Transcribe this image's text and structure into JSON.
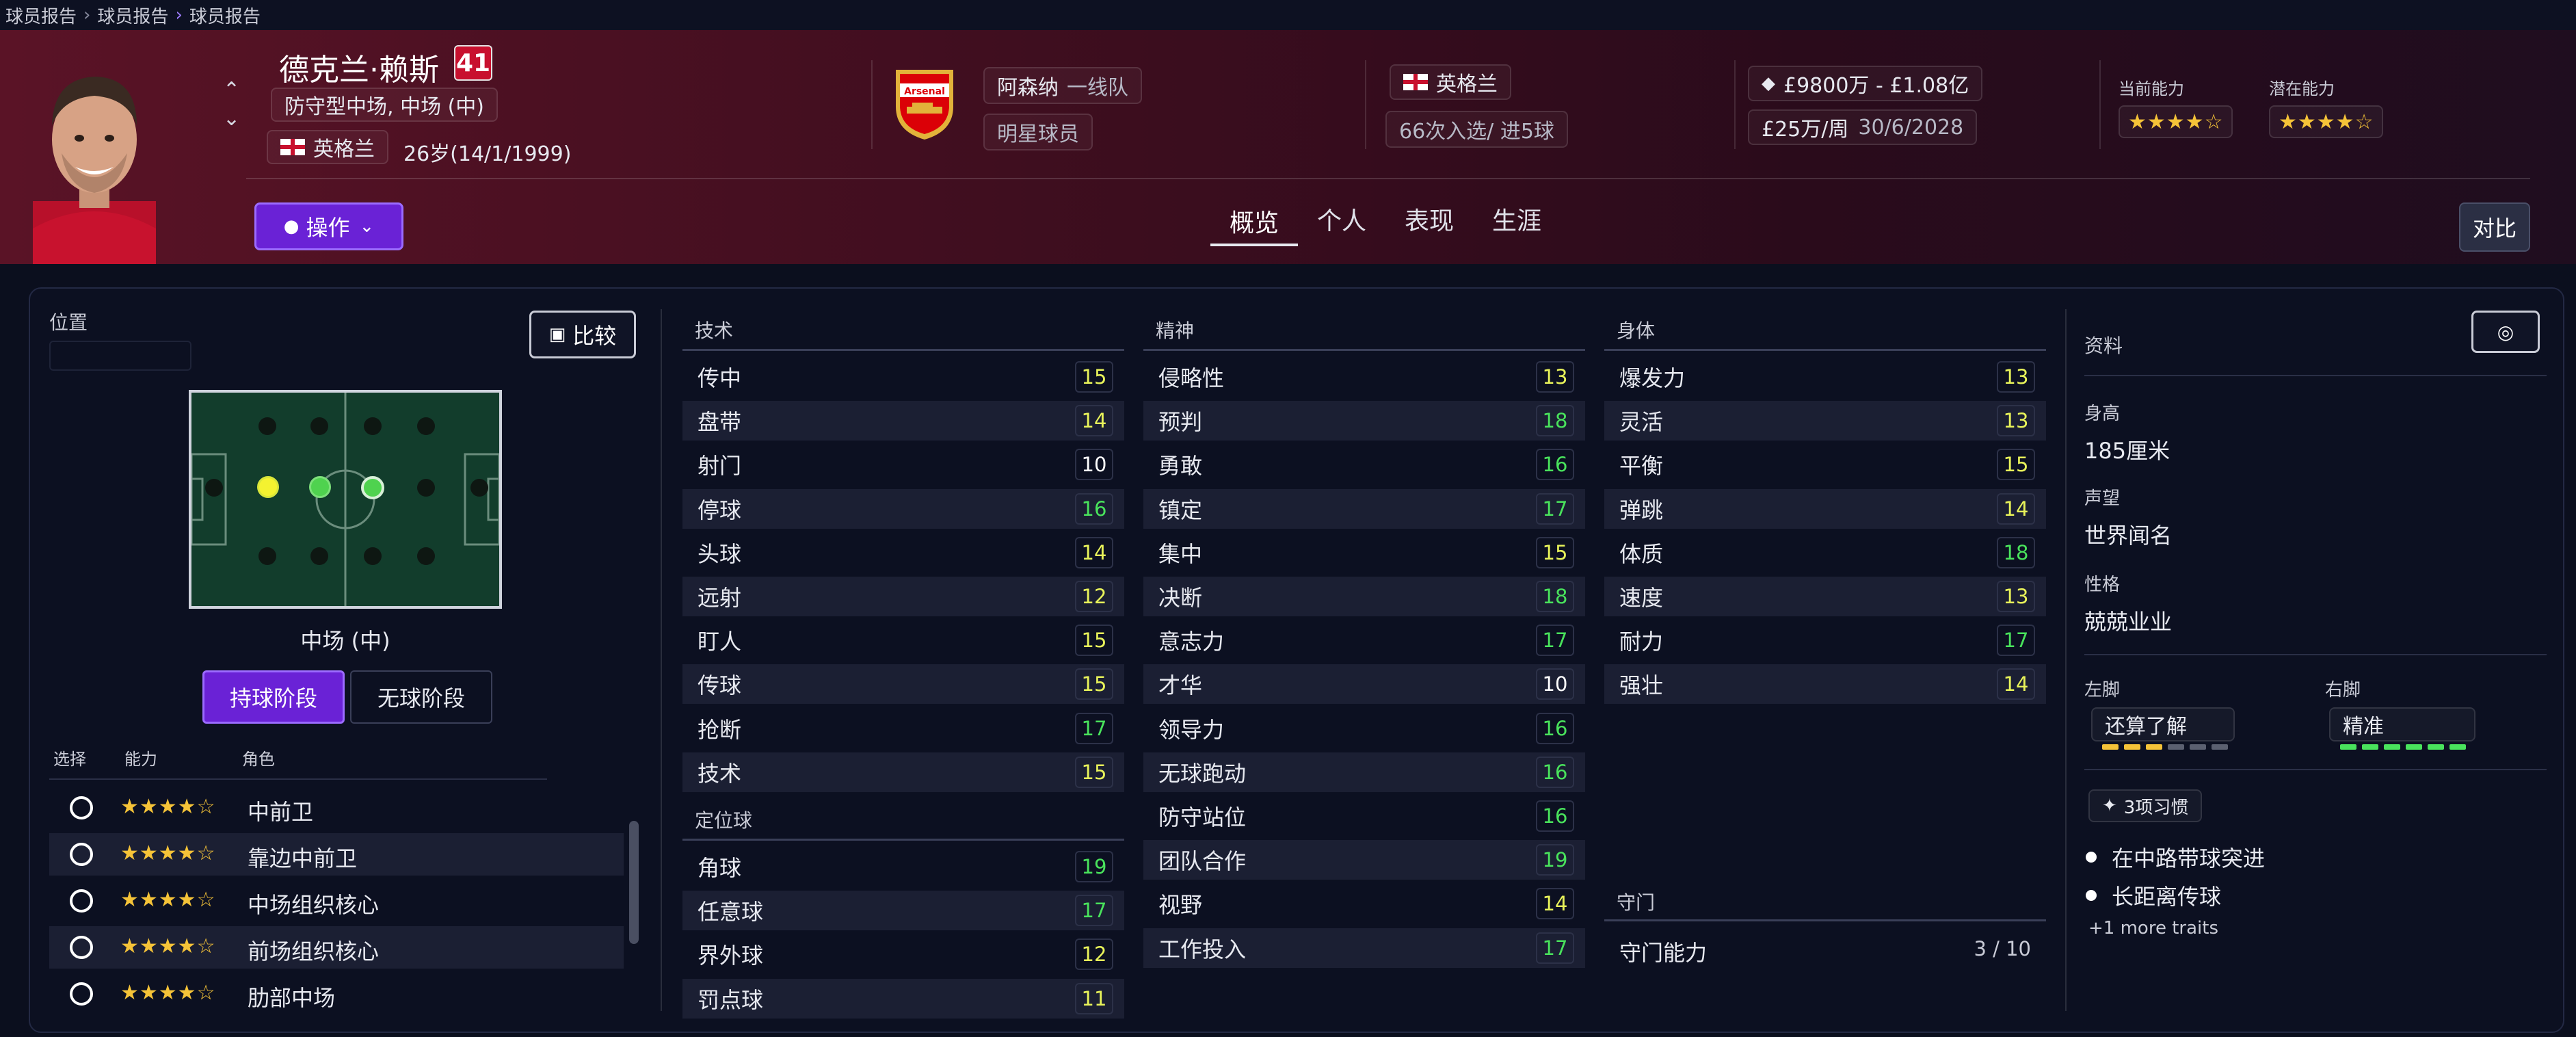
{
  "breadcrumb": [
    "球员报告",
    "球员报告",
    "球员报告"
  ],
  "player": {
    "name": "德克兰·赖斯",
    "number": "41",
    "position": "防守型中场, 中场 (中)",
    "nationality": "英格兰",
    "age": "26岁(14/1/1999)"
  },
  "club": {
    "name": "阿森纳",
    "squad": "一线队",
    "status": "明星球员",
    "crest_text": "Arsenal"
  },
  "international": {
    "country": "英格兰",
    "caps": "66次入选/ 进5球"
  },
  "contract": {
    "value": "£9800万 - £1.08亿",
    "wage": "£25万/周",
    "expiry": "30/6/2028"
  },
  "ability": {
    "current_label": "当前能力",
    "potential_label": "潜在能力",
    "current_stars": "★★★★☆",
    "potential_stars": "★★★★☆"
  },
  "actions_label": "操作",
  "tabs": [
    "概览",
    "个人",
    "表现",
    "生涯"
  ],
  "compare_label": "对比",
  "positions": {
    "title": "位置",
    "compare_button": "比较",
    "pitch_label": "中场 (中)",
    "phase_in": "持球阶段",
    "phase_out": "无球阶段",
    "col_select": "选择",
    "col_ability": "能力",
    "col_role": "角色",
    "roles": [
      {
        "stars": "★★★★☆",
        "name": "中前卫"
      },
      {
        "stars": "★★★★☆",
        "name": "靠边中前卫"
      },
      {
        "stars": "★★★★☆",
        "name": "中场组织核心"
      },
      {
        "stars": "★★★★☆",
        "name": "前场组织核心"
      },
      {
        "stars": "★★★★☆",
        "name": "肋部中场"
      }
    ]
  },
  "technical": {
    "title": "技术",
    "items": [
      {
        "name": "传中",
        "value": "15"
      },
      {
        "name": "盘带",
        "value": "14"
      },
      {
        "name": "射门",
        "value": "10"
      },
      {
        "name": "停球",
        "value": "16"
      },
      {
        "name": "头球",
        "value": "14"
      },
      {
        "name": "远射",
        "value": "12"
      },
      {
        "name": "盯人",
        "value": "15"
      },
      {
        "name": "传球",
        "value": "15"
      },
      {
        "name": "抢断",
        "value": "17"
      },
      {
        "name": "技术",
        "value": "15"
      }
    ]
  },
  "set_pieces": {
    "title": "定位球",
    "items": [
      {
        "name": "角球",
        "value": "19"
      },
      {
        "name": "任意球",
        "value": "17"
      },
      {
        "name": "界外球",
        "value": "12"
      },
      {
        "name": "罚点球",
        "value": "11"
      }
    ]
  },
  "mental": {
    "title": "精神",
    "items": [
      {
        "name": "侵略性",
        "value": "13"
      },
      {
        "name": "预判",
        "value": "18"
      },
      {
        "name": "勇敢",
        "value": "16"
      },
      {
        "name": "镇定",
        "value": "17"
      },
      {
        "name": "集中",
        "value": "15"
      },
      {
        "name": "决断",
        "value": "18"
      },
      {
        "name": "意志力",
        "value": "17"
      },
      {
        "name": "才华",
        "value": "10"
      },
      {
        "name": "领导力",
        "value": "16"
      },
      {
        "name": "无球跑动",
        "value": "16"
      },
      {
        "name": "防守站位",
        "value": "16"
      },
      {
        "name": "团队合作",
        "value": "19"
      },
      {
        "name": "视野",
        "value": "14"
      },
      {
        "name": "工作投入",
        "value": "17"
      }
    ]
  },
  "physical": {
    "title": "身体",
    "items": [
      {
        "name": "爆发力",
        "value": "13"
      },
      {
        "name": "灵活",
        "value": "13"
      },
      {
        "name": "平衡",
        "value": "15"
      },
      {
        "name": "弹跳",
        "value": "14"
      },
      {
        "name": "体质",
        "value": "18"
      },
      {
        "name": "速度",
        "value": "13"
      },
      {
        "name": "耐力",
        "value": "17"
      },
      {
        "name": "强壮",
        "value": "14"
      }
    ]
  },
  "goalkeeping": {
    "title": "守门",
    "label": "守门能力",
    "value": "3 / 10"
  },
  "profile": {
    "title": "资料",
    "height_label": "身高",
    "height": "185厘米",
    "reputation_label": "声望",
    "reputation": "世界闻名",
    "personality_label": "性格",
    "personality": "兢兢业业",
    "left_foot_label": "左脚",
    "left_foot": "还算了解",
    "right_foot_label": "右脚",
    "right_foot": "精准",
    "traits_count": "3项习惯",
    "traits": [
      "在中路带球突进",
      "长距离传球"
    ],
    "more_traits": "+1 more traits"
  },
  "colors": {
    "accent": "#7c2ee6",
    "header_bg": "#4a1024",
    "attr_green": "#49e35c",
    "attr_yellow": "#e8f35a",
    "star": "#f5c338"
  }
}
